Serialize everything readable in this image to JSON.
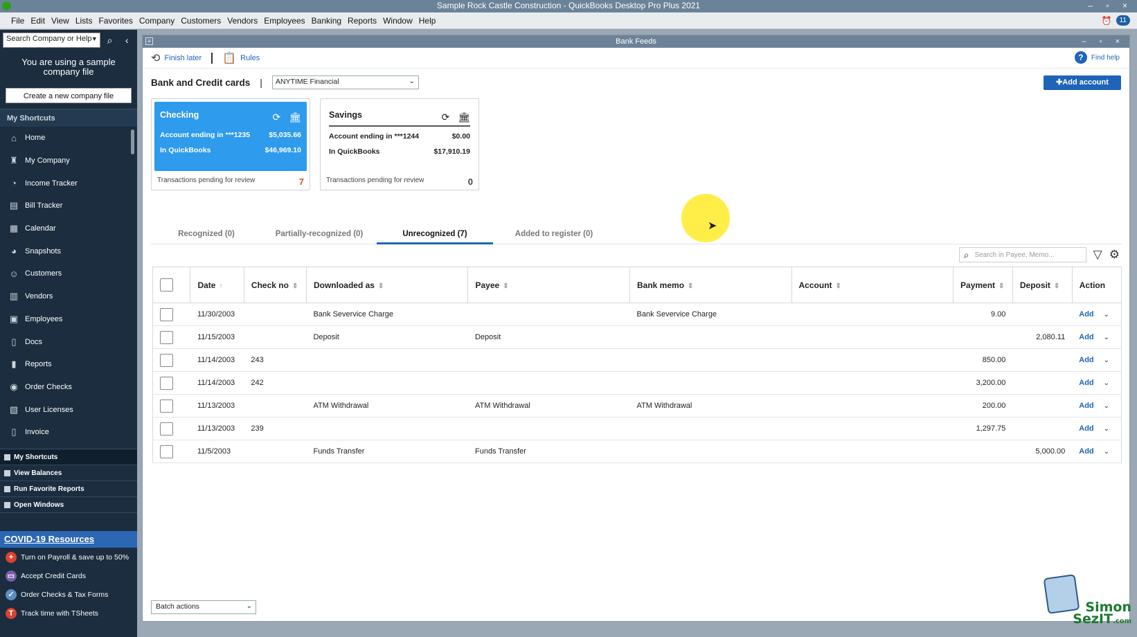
{
  "window": {
    "title": "Sample Rock Castle Construction  - QuickBooks Desktop Pro Plus 2021",
    "controls": "– ▫ ×",
    "notifications": "11"
  },
  "menu": [
    "File",
    "Edit",
    "View",
    "Lists",
    "Favorites",
    "Company",
    "Customers",
    "Vendors",
    "Employees",
    "Banking",
    "Reports",
    "Window",
    "Help"
  ],
  "sidebar": {
    "search_placeholder": "Search Company or Help",
    "sample_notice": "You are using a sample company file",
    "create_button": "Create a new company file",
    "shortcuts_header": "My Shortcuts",
    "items": [
      {
        "label": "Home",
        "icon": "home-icon"
      },
      {
        "label": "My Company",
        "icon": "company-icon"
      },
      {
        "label": "Income Tracker",
        "icon": "income-tracker-icon"
      },
      {
        "label": "Bill Tracker",
        "icon": "bill-tracker-icon"
      },
      {
        "label": "Calendar",
        "icon": "calendar-icon"
      },
      {
        "label": "Snapshots",
        "icon": "snapshots-icon"
      },
      {
        "label": "Customers",
        "icon": "customers-icon"
      },
      {
        "label": "Vendors",
        "icon": "vendors-icon"
      },
      {
        "label": "Employees",
        "icon": "employees-icon"
      },
      {
        "label": "Docs",
        "icon": "docs-icon"
      },
      {
        "label": "Reports",
        "icon": "reports-icon"
      },
      {
        "label": "Order Checks",
        "icon": "order-checks-icon"
      },
      {
        "label": "User Licenses",
        "icon": "user-licenses-icon"
      },
      {
        "label": "Invoice",
        "icon": "invoice-icon"
      }
    ],
    "bottom": [
      "My Shortcuts",
      "View Balances",
      "Run Favorite Reports",
      "Open Windows"
    ],
    "covid_header": "COVID-19 Resources",
    "promos": [
      {
        "label": "Turn on Payroll & save up to 50%",
        "color": "#d9432f",
        "glyph": "+"
      },
      {
        "label": "Accept Credit Cards",
        "color": "#7b5ea7",
        "glyph": "▭"
      },
      {
        "label": "Order Checks & Tax Forms",
        "color": "#5a8fc4",
        "glyph": "✓"
      },
      {
        "label": "Track time with TSheets",
        "color": "#d9432f",
        "glyph": "T"
      }
    ]
  },
  "bankfeeds": {
    "window_title": "Bank Feeds",
    "finish_later": "Finish later",
    "rules": "Rules",
    "find_help": "Find help",
    "section_title": "Bank and Credit cards",
    "bank_selected": "ANYTIME Financial",
    "add_account": "✚Add account",
    "accounts": [
      {
        "name": "Checking",
        "ending_label": "Account ending in ***1235",
        "bank_balance": "$5,035.66",
        "qb_label": "In QuickBooks",
        "qb_balance": "$46,969.10",
        "pending_label": "Transactions pending for review",
        "pending": "7"
      },
      {
        "name": "Savings",
        "ending_label": "Account ending in ***1244",
        "bank_balance": "$0.00",
        "qb_label": "In QuickBooks",
        "qb_balance": "$17,910.19",
        "pending_label": "Transactions pending for review",
        "pending": "0"
      }
    ],
    "tabs": [
      "Recognized (0)",
      "Partially-recognized (0)",
      "Unrecognized (7)",
      "Added to register (0)"
    ],
    "active_tab": 2,
    "search_placeholder": "Search in Payee, Memo...",
    "columns": [
      "Date",
      "Check no",
      "Downloaded as",
      "Payee",
      "Bank memo",
      "Account",
      "Payment",
      "Deposit",
      "Action"
    ],
    "rows": [
      {
        "date": "11/30/2003",
        "check": "",
        "downloaded": "Bank Severvice Charge",
        "payee": "",
        "memo": "Bank Severvice Charge",
        "account": "",
        "payment": "9.00",
        "deposit": "",
        "action": "Add"
      },
      {
        "date": "11/15/2003",
        "check": "",
        "downloaded": "Deposit",
        "payee": "Deposit",
        "memo": "",
        "account": "",
        "payment": "",
        "deposit": "2,080.11",
        "action": "Add"
      },
      {
        "date": "11/14/2003",
        "check": "243",
        "downloaded": "",
        "payee": "",
        "memo": "",
        "account": "",
        "payment": "850.00",
        "deposit": "",
        "action": "Add"
      },
      {
        "date": "11/14/2003",
        "check": "242",
        "downloaded": "",
        "payee": "",
        "memo": "",
        "account": "",
        "payment": "3,200.00",
        "deposit": "",
        "action": "Add"
      },
      {
        "date": "11/13/2003",
        "check": "",
        "downloaded": "ATM Withdrawal",
        "payee": "ATM Withdrawal",
        "memo": "ATM Withdrawal",
        "account": "",
        "payment": "200.00",
        "deposit": "",
        "action": "Add"
      },
      {
        "date": "11/13/2003",
        "check": "239",
        "downloaded": "",
        "payee": "",
        "memo": "",
        "account": "",
        "payment": "1,297.75",
        "deposit": "",
        "action": "Add"
      },
      {
        "date": "11/5/2003",
        "check": "",
        "downloaded": "Funds Transfer",
        "payee": "Funds Transfer",
        "memo": "",
        "account": "",
        "payment": "",
        "deposit": "5,000.00",
        "action": "Add"
      }
    ],
    "batch_actions": "Batch actions"
  },
  "watermark": {
    "line1": "Simon",
    "line2": "SezIT",
    "line3": ".com"
  },
  "colors": {
    "accent": "#1f64b8",
    "checking_card": "#2e9bec",
    "pending_alert": "#d0521b",
    "sidebar_bg": "#1b2d3f"
  }
}
